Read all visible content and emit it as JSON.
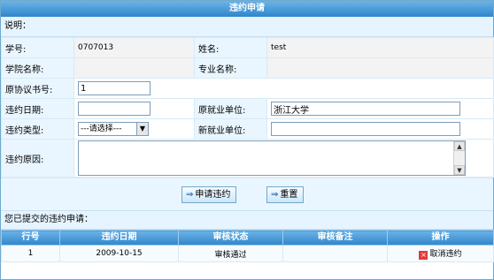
{
  "window": {
    "title": "违约申请"
  },
  "note_label": "说明：",
  "form": {
    "student_id_label": "学号:",
    "student_id_value": "0707013",
    "name_label": "姓名:",
    "name_value": "test",
    "college_label": "学院名称:",
    "college_value": "",
    "major_label": "专业名称:",
    "major_value": "",
    "agreement_no_label": "原协议书号:",
    "agreement_no_value": "1",
    "breach_date_label": "违约日期:",
    "breach_date_value": "",
    "orig_employer_label": "原就业单位:",
    "orig_employer_value": "浙江大学",
    "breach_type_label": "违约类型:",
    "breach_type_selected": "---请选择---",
    "new_employer_label": "新就业单位:",
    "new_employer_value": "",
    "reason_label": "违约原因:",
    "reason_value": ""
  },
  "buttons": {
    "apply_label": "申请违约",
    "reset_label": "重置"
  },
  "submitted": {
    "heading": "您已提交的违约申请：",
    "columns": [
      "行号",
      "违约日期",
      "审核状态",
      "审核备注",
      "操作"
    ],
    "rows": [
      {
        "row_no": "1",
        "date": "2009-10-15",
        "status": "审核通过",
        "remark": "",
        "action": "取消违约"
      }
    ]
  },
  "colors": {
    "header_blue": "#2e86cc",
    "label_bg": "#eaf6ff"
  }
}
